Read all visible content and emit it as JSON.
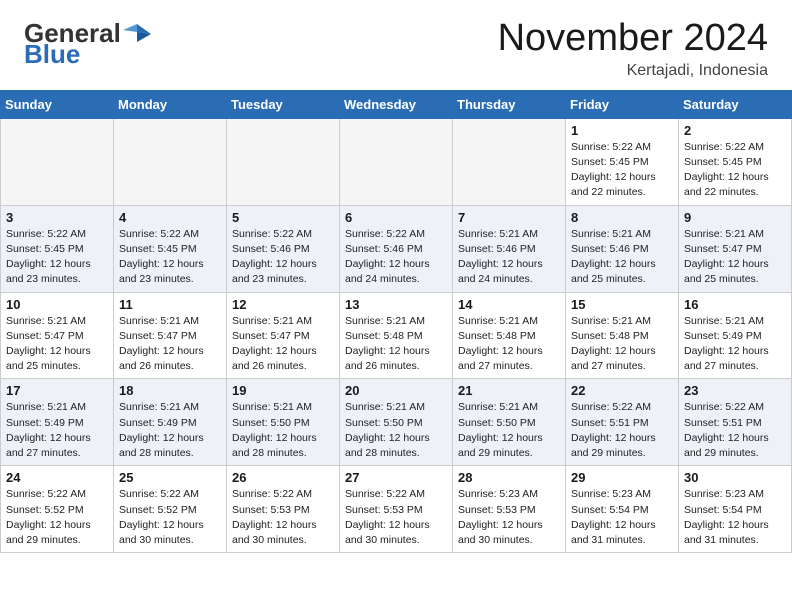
{
  "header": {
    "logo_general": "General",
    "logo_blue": "Blue",
    "month": "November 2024",
    "location": "Kertajadi, Indonesia"
  },
  "weekdays": [
    "Sunday",
    "Monday",
    "Tuesday",
    "Wednesday",
    "Thursday",
    "Friday",
    "Saturday"
  ],
  "weeks": [
    [
      {
        "day": "",
        "info": ""
      },
      {
        "day": "",
        "info": ""
      },
      {
        "day": "",
        "info": ""
      },
      {
        "day": "",
        "info": ""
      },
      {
        "day": "",
        "info": ""
      },
      {
        "day": "1",
        "info": "Sunrise: 5:22 AM\nSunset: 5:45 PM\nDaylight: 12 hours\nand 22 minutes."
      },
      {
        "day": "2",
        "info": "Sunrise: 5:22 AM\nSunset: 5:45 PM\nDaylight: 12 hours\nand 22 minutes."
      }
    ],
    [
      {
        "day": "3",
        "info": "Sunrise: 5:22 AM\nSunset: 5:45 PM\nDaylight: 12 hours\nand 23 minutes."
      },
      {
        "day": "4",
        "info": "Sunrise: 5:22 AM\nSunset: 5:45 PM\nDaylight: 12 hours\nand 23 minutes."
      },
      {
        "day": "5",
        "info": "Sunrise: 5:22 AM\nSunset: 5:46 PM\nDaylight: 12 hours\nand 23 minutes."
      },
      {
        "day": "6",
        "info": "Sunrise: 5:22 AM\nSunset: 5:46 PM\nDaylight: 12 hours\nand 24 minutes."
      },
      {
        "day": "7",
        "info": "Sunrise: 5:21 AM\nSunset: 5:46 PM\nDaylight: 12 hours\nand 24 minutes."
      },
      {
        "day": "8",
        "info": "Sunrise: 5:21 AM\nSunset: 5:46 PM\nDaylight: 12 hours\nand 25 minutes."
      },
      {
        "day": "9",
        "info": "Sunrise: 5:21 AM\nSunset: 5:47 PM\nDaylight: 12 hours\nand 25 minutes."
      }
    ],
    [
      {
        "day": "10",
        "info": "Sunrise: 5:21 AM\nSunset: 5:47 PM\nDaylight: 12 hours\nand 25 minutes."
      },
      {
        "day": "11",
        "info": "Sunrise: 5:21 AM\nSunset: 5:47 PM\nDaylight: 12 hours\nand 26 minutes."
      },
      {
        "day": "12",
        "info": "Sunrise: 5:21 AM\nSunset: 5:47 PM\nDaylight: 12 hours\nand 26 minutes."
      },
      {
        "day": "13",
        "info": "Sunrise: 5:21 AM\nSunset: 5:48 PM\nDaylight: 12 hours\nand 26 minutes."
      },
      {
        "day": "14",
        "info": "Sunrise: 5:21 AM\nSunset: 5:48 PM\nDaylight: 12 hours\nand 27 minutes."
      },
      {
        "day": "15",
        "info": "Sunrise: 5:21 AM\nSunset: 5:48 PM\nDaylight: 12 hours\nand 27 minutes."
      },
      {
        "day": "16",
        "info": "Sunrise: 5:21 AM\nSunset: 5:49 PM\nDaylight: 12 hours\nand 27 minutes."
      }
    ],
    [
      {
        "day": "17",
        "info": "Sunrise: 5:21 AM\nSunset: 5:49 PM\nDaylight: 12 hours\nand 27 minutes."
      },
      {
        "day": "18",
        "info": "Sunrise: 5:21 AM\nSunset: 5:49 PM\nDaylight: 12 hours\nand 28 minutes."
      },
      {
        "day": "19",
        "info": "Sunrise: 5:21 AM\nSunset: 5:50 PM\nDaylight: 12 hours\nand 28 minutes."
      },
      {
        "day": "20",
        "info": "Sunrise: 5:21 AM\nSunset: 5:50 PM\nDaylight: 12 hours\nand 28 minutes."
      },
      {
        "day": "21",
        "info": "Sunrise: 5:21 AM\nSunset: 5:50 PM\nDaylight: 12 hours\nand 29 minutes."
      },
      {
        "day": "22",
        "info": "Sunrise: 5:22 AM\nSunset: 5:51 PM\nDaylight: 12 hours\nand 29 minutes."
      },
      {
        "day": "23",
        "info": "Sunrise: 5:22 AM\nSunset: 5:51 PM\nDaylight: 12 hours\nand 29 minutes."
      }
    ],
    [
      {
        "day": "24",
        "info": "Sunrise: 5:22 AM\nSunset: 5:52 PM\nDaylight: 12 hours\nand 29 minutes."
      },
      {
        "day": "25",
        "info": "Sunrise: 5:22 AM\nSunset: 5:52 PM\nDaylight: 12 hours\nand 30 minutes."
      },
      {
        "day": "26",
        "info": "Sunrise: 5:22 AM\nSunset: 5:53 PM\nDaylight: 12 hours\nand 30 minutes."
      },
      {
        "day": "27",
        "info": "Sunrise: 5:22 AM\nSunset: 5:53 PM\nDaylight: 12 hours\nand 30 minutes."
      },
      {
        "day": "28",
        "info": "Sunrise: 5:23 AM\nSunset: 5:53 PM\nDaylight: 12 hours\nand 30 minutes."
      },
      {
        "day": "29",
        "info": "Sunrise: 5:23 AM\nSunset: 5:54 PM\nDaylight: 12 hours\nand 31 minutes."
      },
      {
        "day": "30",
        "info": "Sunrise: 5:23 AM\nSunset: 5:54 PM\nDaylight: 12 hours\nand 31 minutes."
      }
    ]
  ]
}
